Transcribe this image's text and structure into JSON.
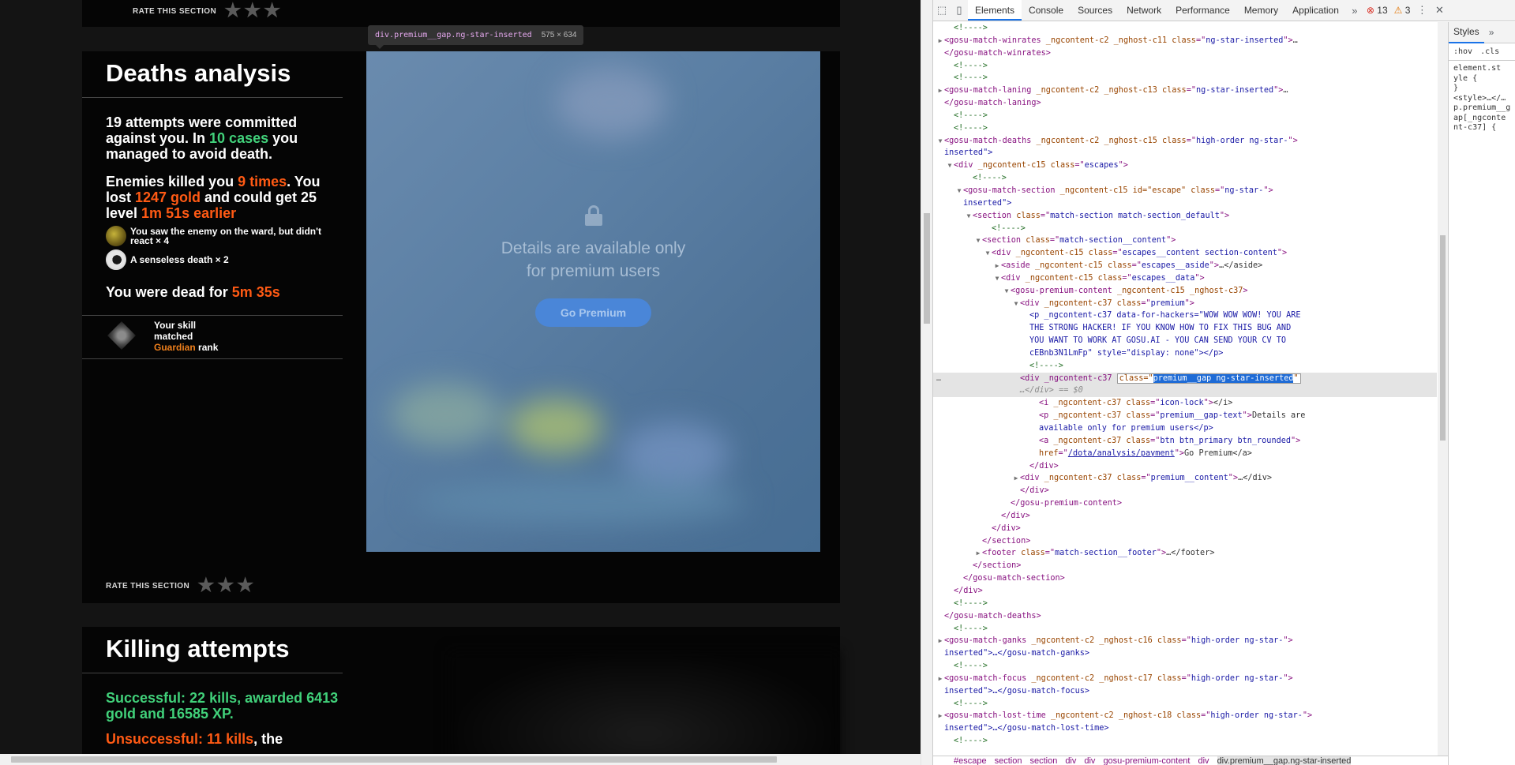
{
  "tooltip": {
    "selector": "div.premium__gap.ng-star-inserted",
    "size": "575 × 634"
  },
  "top_rate": {
    "label": "RATE THIS SECTION"
  },
  "deaths": {
    "title": "Deaths analysis",
    "p1": {
      "a": "19 attempts were committed against you. In ",
      "b": "10 cases",
      "c": " you managed to avoid death."
    },
    "p2": {
      "a": "Enemies killed you ",
      "b": "9 times",
      "c": ". You lost ",
      "d": "1247 gold",
      "e": " and could get 25 level ",
      "f": "1m 51s earlier"
    },
    "events": [
      {
        "text": "You saw the enemy on the ward, but didn't react × 4"
      },
      {
        "text": "A senseless death × 2"
      }
    ],
    "dead": {
      "a": "You were dead for ",
      "b": "5m 35s"
    },
    "skill": {
      "a": "Your skill matched",
      "rank": "Guardian",
      "b": " rank"
    },
    "premium": {
      "text": "Details are available only for premium users",
      "button": "Go Premium"
    },
    "rate": "RATE THIS SECTION"
  },
  "killing": {
    "title": "Killing attempts",
    "success": "Successful: 22 kills, awarded 6413 gold and 16585 XP.",
    "unsuccess_a": "Unsuccessful: 11 kills",
    "unsuccess_b": ", the"
  },
  "devtools": {
    "tabs": [
      "Elements",
      "Console",
      "Sources",
      "Network",
      "Performance",
      "Memory",
      "Application"
    ],
    "errors": "13",
    "warnings": "3",
    "styles_tab": "Styles",
    "filters": [
      ":hov",
      ".cls"
    ],
    "breadcrumbs": [
      "#escape",
      "section",
      "section",
      "div",
      "div",
      "gosu-premium-content",
      "div",
      "div.premium__gap.ng-star-inserted"
    ],
    "dom_lines": [
      {
        "i": 9,
        "t": "<!---->"
      },
      {
        "i": 8,
        "tw": "▶",
        "tag": "gosu-match-winrates",
        "attrs": " _ngcontent-c2 _nghost-c11 ",
        "cls": "ng-star-inserted",
        "tail": "…"
      },
      {
        "i": 8,
        "end": "</gosu-match-winrates>"
      },
      {
        "i": 9,
        "t": "<!---->"
      },
      {
        "i": 9,
        "t": "<!---->"
      },
      {
        "i": 8,
        "tw": "▶",
        "tag": "gosu-match-laning",
        "attrs": " _ngcontent-c2 _nghost-c13 ",
        "cls": "ng-star-inserted",
        "tail": "…"
      },
      {
        "i": 8,
        "end": "</gosu-match-laning>"
      },
      {
        "i": 9,
        "t": "<!---->"
      },
      {
        "i": 9,
        "t": "<!---->"
      },
      {
        "i": 8,
        "tw": "▼",
        "tag": "gosu-match-deaths",
        "attrs": " _ngcontent-c2 _nghost-c15 ",
        "cls": "high-order ng-star-"
      },
      {
        "i": 8,
        "raw": "inserted\">"
      },
      {
        "i": 9,
        "tw": "▼",
        "tag": "div",
        "attrs": " _ngcontent-c15 ",
        "cls": "escapes"
      },
      {
        "i": 11,
        "t": "<!---->"
      },
      {
        "i": 10,
        "tw": "▼",
        "tag": "gosu-match-section",
        "attrs": " _ngcontent-c15 id=\"escape\" ",
        "cls": "ng-star-"
      },
      {
        "i": 10,
        "raw": "inserted\">"
      },
      {
        "i": 11,
        "tw": "▼",
        "tag": "section",
        "attrs": " ",
        "cls": "match-section match-section_default"
      },
      {
        "i": 13,
        "t": "<!---->"
      },
      {
        "i": 12,
        "tw": "▼",
        "tag": "section",
        "attrs": " ",
        "cls": "match-section__content"
      },
      {
        "i": 13,
        "tw": "▼",
        "tag": "div",
        "attrs": " _ngcontent-c15 ",
        "cls": "escapes__content section-content"
      },
      {
        "i": 14,
        "tw": "▶",
        "tag": "aside",
        "attrs": " _ngcontent-c15 ",
        "cls": "escapes__aside",
        "tail": "…</aside>"
      },
      {
        "i": 14,
        "tw": "▼",
        "tag": "div",
        "attrs": " _ngcontent-c15 ",
        "cls": "escapes__data"
      },
      {
        "i": 15,
        "tw": "▼",
        "tag": "gosu-premium-content",
        "attrs": " _ngcontent-c15 _nghost-c37",
        "nocls": true
      },
      {
        "i": 16,
        "tw": "▼",
        "tag": "div",
        "attrs": " _ngcontent-c37 ",
        "cls": "premium"
      },
      {
        "i": 17,
        "p": "<p _ngcontent-c37 data-for-hackers=\"WOW WOW WOW! YOU ARE"
      },
      {
        "i": 17,
        "p": "THE STRONG HACKER! IF YOU KNOW HOW TO FIX THIS BUG AND"
      },
      {
        "i": 17,
        "p": "YOU WANT TO WORK AT GOSU.AI - YOU CAN SEND YOUR CV TO"
      },
      {
        "i": 17,
        "p": "cEBnb3N1LmFp\" style=\"display: none\"></p>"
      },
      {
        "i": 17,
        "t": "<!---->"
      },
      {
        "i": 16,
        "sel": true
      },
      {
        "i": 16,
        "selend": "…</div> == $0"
      },
      {
        "i": 18,
        "tag": "i",
        "attrs": " _ngcontent-c37 ",
        "cls": "icon-lock",
        "tail": "</i>"
      },
      {
        "i": 18,
        "tag": "p",
        "attrs": " _ngcontent-c37 ",
        "cls": "premium__gap-text",
        "tail": "Details are"
      },
      {
        "i": 18,
        "raw": "available only for premium users</p>"
      },
      {
        "i": 18,
        "tag": "a",
        "attrs": " _ngcontent-c37 ",
        "cls": "btn btn_primary btn_rounded"
      },
      {
        "i": 18,
        "href": "/dota/analysis/payment",
        "hreftail": "Go Premium</a>"
      },
      {
        "i": 17,
        "end": "</div>"
      },
      {
        "i": 16,
        "tw": "▶",
        "tag": "div",
        "attrs": " _ngcontent-c37 ",
        "cls": "premium__content",
        "tail": "…</div>"
      },
      {
        "i": 16,
        "end": "</div>"
      },
      {
        "i": 15,
        "end": "</gosu-premium-content>"
      },
      {
        "i": 14,
        "end": "</div>"
      },
      {
        "i": 13,
        "end": "</div>"
      },
      {
        "i": 12,
        "end": "</section>"
      },
      {
        "i": 12,
        "tw": "▶",
        "tag": "footer",
        "attrs": " ",
        "cls": "match-section__footer",
        "tail": "…</footer>"
      },
      {
        "i": 11,
        "end": "</section>"
      },
      {
        "i": 10,
        "end": "</gosu-match-section>"
      },
      {
        "i": 9,
        "end": "</div>"
      },
      {
        "i": 9,
        "t": "<!---->"
      },
      {
        "i": 8,
        "end": "</gosu-match-deaths>"
      },
      {
        "i": 9,
        "t": "<!---->"
      },
      {
        "i": 8,
        "tw": "▶",
        "tag": "gosu-match-ganks",
        "attrs": " _ngcontent-c2 _nghost-c16 ",
        "cls": "high-order ng-star-"
      },
      {
        "i": 8,
        "raw": "inserted\">…</gosu-match-ganks>"
      },
      {
        "i": 9,
        "t": "<!---->"
      },
      {
        "i": 8,
        "tw": "▶",
        "tag": "gosu-match-focus",
        "attrs": " _ngcontent-c2 _nghost-c17 ",
        "cls": "high-order ng-star-"
      },
      {
        "i": 8,
        "raw": "inserted\">…</gosu-match-focus>"
      },
      {
        "i": 9,
        "t": "<!---->"
      },
      {
        "i": 8,
        "tw": "▶",
        "tag": "gosu-match-lost-time",
        "attrs": " _ngcontent-c2 _nghost-c18 ",
        "cls": "high-order ng-star-"
      },
      {
        "i": 8,
        "raw": "inserted\">…</gosu-match-lost-time>"
      },
      {
        "i": 9,
        "t": "<!---->"
      }
    ],
    "selected": {
      "open": "<div _ngcontent-c37 ",
      "attr": "class=\"",
      "value": "premium__gap ng-star-inserted"
    },
    "styles_lines": [
      "element.st",
      "yle {",
      "}",
      "<style>…</…",
      "p.premium__g",
      "ap[_ngconte",
      "nt-c37] {"
    ]
  },
  "colors": {
    "green": "#41d17a",
    "orange": "#ff5a14",
    "gold": "#f0801c",
    "accent": "#1a73e8"
  }
}
